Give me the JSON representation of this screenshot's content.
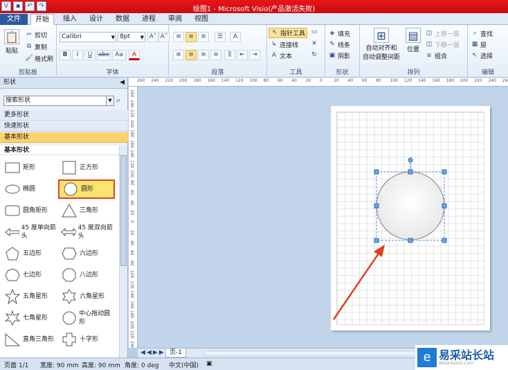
{
  "title": "绘图1 - Microsoft Visio(产品激活失败)",
  "tabs": [
    "文件",
    "开始",
    "插入",
    "设计",
    "数据",
    "进程",
    "审阅",
    "视图"
  ],
  "active_tab": "开始",
  "ribbon": {
    "clipboard": {
      "paste": "粘贴",
      "cut": "剪切",
      "copy": "复制",
      "format_painter": "格式刷",
      "label": "剪贴板"
    },
    "font": {
      "name": "Calibri",
      "size": "8pt",
      "label": "字体",
      "bold": "B",
      "italic": "I",
      "underline": "U",
      "strike": "abc",
      "aa": "Aa",
      "color": "A"
    },
    "paragraph": {
      "label": "段落"
    },
    "tools": {
      "pointer": "指针工具",
      "connector": "连接线",
      "text": "文本",
      "label": "工具"
    },
    "shape": {
      "fill": "填充",
      "line": "线条",
      "shadow": "阴影",
      "label": "形状"
    },
    "arrange": {
      "auto_align": "自动对齐和",
      "auto_space": "自动调整间距",
      "position": "位置",
      "bring_forward": "上移一层",
      "send_backward": "下移一层",
      "group": "组合",
      "label": "排列"
    },
    "editing": {
      "find": "查找",
      "layers": "层",
      "select": "选择",
      "label": "编辑"
    }
  },
  "pane": {
    "title": "形状",
    "search_placeholder": "搜索形状",
    "sections": [
      "更多形状",
      "快速形状",
      "基本形状"
    ],
    "stencil_title": "基本形状",
    "shapes": [
      {
        "label": "矩形",
        "icon": "rect"
      },
      {
        "label": "正方形",
        "icon": "square"
      },
      {
        "label": "椭圆",
        "icon": "ellipse"
      },
      {
        "label": "圆形",
        "icon": "circle",
        "highlighted": true
      },
      {
        "label": "圆角矩形",
        "icon": "rounded-rect"
      },
      {
        "label": "三角形",
        "icon": "triangle"
      },
      {
        "label": "45 度单向箭头",
        "icon": "arrow"
      },
      {
        "label": "45 度双向箭头",
        "icon": "double-arrow"
      },
      {
        "label": "五边形",
        "icon": "pentagon"
      },
      {
        "label": "六边形",
        "icon": "hexagon"
      },
      {
        "label": "七边形",
        "icon": "heptagon"
      },
      {
        "label": "八边形",
        "icon": "octagon"
      },
      {
        "label": "五角星形",
        "icon": "star5"
      },
      {
        "label": "六角星形",
        "icon": "star6"
      },
      {
        "label": "七角星形",
        "icon": "star7"
      },
      {
        "label": "中心拖动圆形",
        "icon": "center-circle"
      },
      {
        "label": "直角三角形",
        "icon": "right-triangle"
      },
      {
        "label": "十字形",
        "icon": "cross"
      }
    ]
  },
  "ruler_labels": [
    "260",
    "240",
    "220",
    "200",
    "180",
    "160",
    "140",
    "120",
    "100",
    "80",
    "60",
    "40",
    "20",
    "0",
    "20",
    "40",
    "60",
    "80",
    "100",
    "120",
    "140",
    "160",
    "180",
    "200",
    "220",
    "240",
    "260"
  ],
  "page_tab": "页-1",
  "status": {
    "page": "页面 1/1",
    "width": "宽度: 90 mm",
    "height": "高度: 90 mm",
    "angle": "角度: 0 deg",
    "lang": "中文(中国)"
  },
  "watermark": {
    "name": "易采站长站",
    "url": "Www.Easck.Com"
  },
  "colors": {
    "title_bar": "#d5151b",
    "file_tab": "#2c5aa0",
    "highlight": "#fbe46f",
    "arrow": "#e2401e"
  }
}
